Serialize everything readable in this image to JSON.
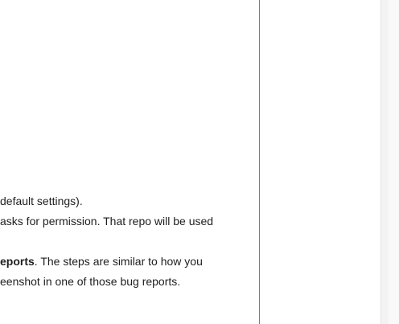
{
  "document": {
    "lines": [
      {
        "text": "default settings)."
      },
      {
        "text": "asks for permission. That repo will be used"
      },
      {
        "text": ""
      },
      {
        "bold": "eports",
        "rest": ". The steps are similar to how you"
      },
      {
        "text": "eenshot in one of those bug reports."
      }
    ]
  },
  "colors": {
    "divider": "#2aa198",
    "text": "#1e1e1e",
    "scrollbar_track": "#f3f3f3"
  }
}
